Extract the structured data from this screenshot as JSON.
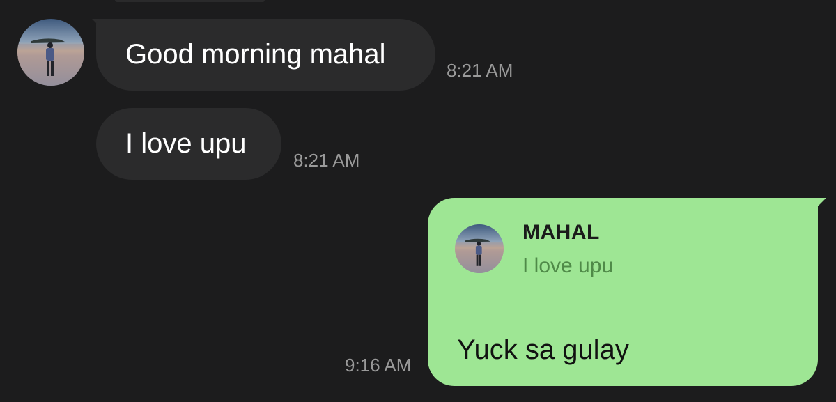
{
  "conversation": {
    "incoming": [
      {
        "text": "Good morning mahal",
        "time": "8:21 AM"
      },
      {
        "text": "I love upu",
        "time": "8:21 AM"
      }
    ],
    "outgoing": {
      "reply_to": {
        "name": "MAHAL",
        "text": "I love upu"
      },
      "text": "Yuck sa gulay",
      "time": "9:16 AM"
    }
  },
  "colors": {
    "background": "#1c1c1d",
    "incoming_bubble": "#2b2b2c",
    "outgoing_bubble": "#9ee694",
    "quote_text": "#4f8a48",
    "timestamp": "#9a9a9a"
  }
}
